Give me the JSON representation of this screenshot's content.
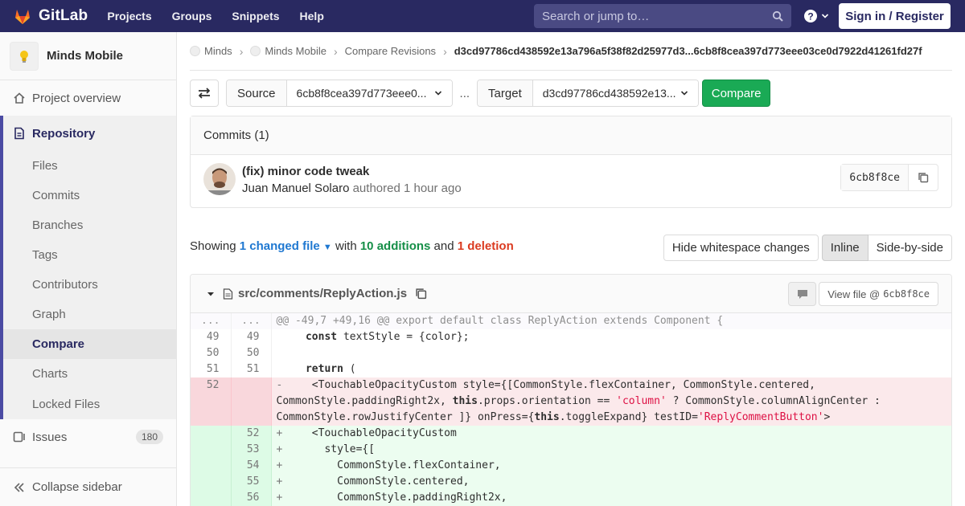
{
  "navbar": {
    "brand": "GitLab",
    "links": [
      "Projects",
      "Groups",
      "Snippets",
      "Help"
    ],
    "search_placeholder": "Search or jump to…",
    "signin_label": "Sign in / Register"
  },
  "sidebar": {
    "project_name": "Minds Mobile",
    "overview_label": "Project overview",
    "repository_label": "Repository",
    "repo_items": [
      "Files",
      "Commits",
      "Branches",
      "Tags",
      "Contributors",
      "Graph",
      "Compare",
      "Charts",
      "Locked Files"
    ],
    "active_item": "Compare",
    "issues_label": "Issues",
    "issues_count": "180",
    "collapse_label": "Collapse sidebar"
  },
  "breadcrumbs": [
    "Minds",
    "Minds Mobile",
    "Compare Revisions",
    "d3cd97786cd438592e13a796a5f38f82d25977d3...6cb8f8cea397d773eee03ce0d7922d41261fd27f"
  ],
  "compare": {
    "source_label": "Source",
    "source_value": "6cb8f8cea397d773eee0...",
    "dots": "...",
    "target_label": "Target",
    "target_value": "d3cd97786cd438592e13...",
    "compare_label": "Compare"
  },
  "commits": {
    "header": "Commits (1)",
    "title": "(fix) minor code tweak",
    "author": "Juan Manuel Solaro",
    "authored_text": "authored 1 hour ago",
    "sha": "6cb8f8ce"
  },
  "stats": {
    "showing": "Showing",
    "changed": "1 changed file",
    "with": "with",
    "additions": "10 additions",
    "and": "and",
    "deletion": "1 deletion"
  },
  "view_tools": {
    "whitespace": "Hide whitespace changes",
    "inline": "Inline",
    "side_by_side": "Side-by-side"
  },
  "file": {
    "path": "src/comments/ReplyAction.js",
    "view_file_prefix": "View file @",
    "view_file_sha": "6cb8f8ce"
  },
  "diff": {
    "hunk_old": "...",
    "hunk_new": "...",
    "hunk_header": "@@ -49,7 +49,16 @@ export default class ReplyAction extends Component {",
    "line1_old": "49",
    "line1_new": "49",
    "line1_kw": "const",
    "line1_rest": " textStyle = {color};",
    "line2_old": "50",
    "line2_new": "50",
    "line3_old": "51",
    "line3_new": "51",
    "line3_kw": "return",
    "line3_rest": " (",
    "del_old": "52",
    "del_sign": "-",
    "del_p1": "    <TouchableOpacityCustom style={[CommonStyle.flexContainer, CommonStyle.centered,",
    "del_p2": "CommonStyle.paddingRight2x, ",
    "del_kw1": "this",
    "del_p3": ".props.orientation == ",
    "del_str1": "'column'",
    "del_p4": " ? CommonStyle.columnAlignCenter :",
    "del_p5": "CommonStyle.rowJustifyCenter ]} onPress={",
    "del_kw2": "this",
    "del_p6": ".toggleExpand} testID=",
    "del_str2": "'ReplyCommentButton'",
    "del_p7": ">",
    "add_sign": "+",
    "add1_new": "52",
    "add1_text": "    <TouchableOpacityCustom",
    "add2_new": "53",
    "add2_text": "      style={[",
    "add3_new": "54",
    "add3_text": "        CommonStyle.flexContainer,",
    "add4_new": "55",
    "add4_text": "        CommonStyle.centered,",
    "add5_new": "56",
    "add5_text": "        CommonStyle.paddingRight2x,"
  }
}
